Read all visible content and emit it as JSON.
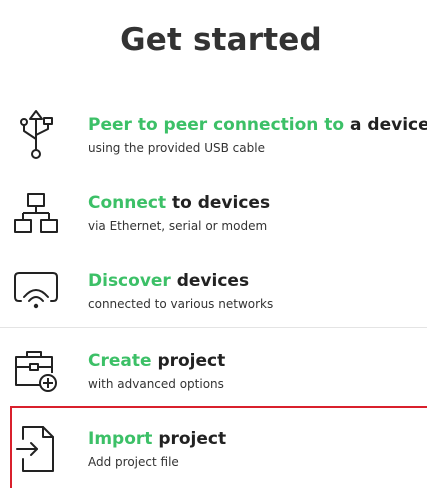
{
  "page": {
    "title": "Get started"
  },
  "items": [
    {
      "id": "peer",
      "highlight": "Peer to peer connection to",
      "rest": " a device",
      "subtitle": "using the provided USB cable",
      "icon": "usb-icon"
    },
    {
      "id": "connect",
      "highlight": "Connect",
      "rest": " to devices",
      "subtitle": "via Ethernet, serial or modem",
      "icon": "network-icon"
    },
    {
      "id": "discover",
      "highlight": "Discover",
      "rest": " devices",
      "subtitle": "connected to various networks",
      "icon": "wifi-discover-icon"
    },
    {
      "id": "create",
      "highlight": "Create",
      "rest": " project",
      "subtitle": "with advanced options",
      "icon": "briefcase-add-icon"
    },
    {
      "id": "import",
      "highlight": "Import",
      "rest": " project",
      "subtitle": "Add project file",
      "icon": "file-import-icon"
    }
  ],
  "colors": {
    "accent": "#3cc067",
    "selection": "#d9202c",
    "text": "#222222",
    "separator": "#e4e4e4"
  }
}
